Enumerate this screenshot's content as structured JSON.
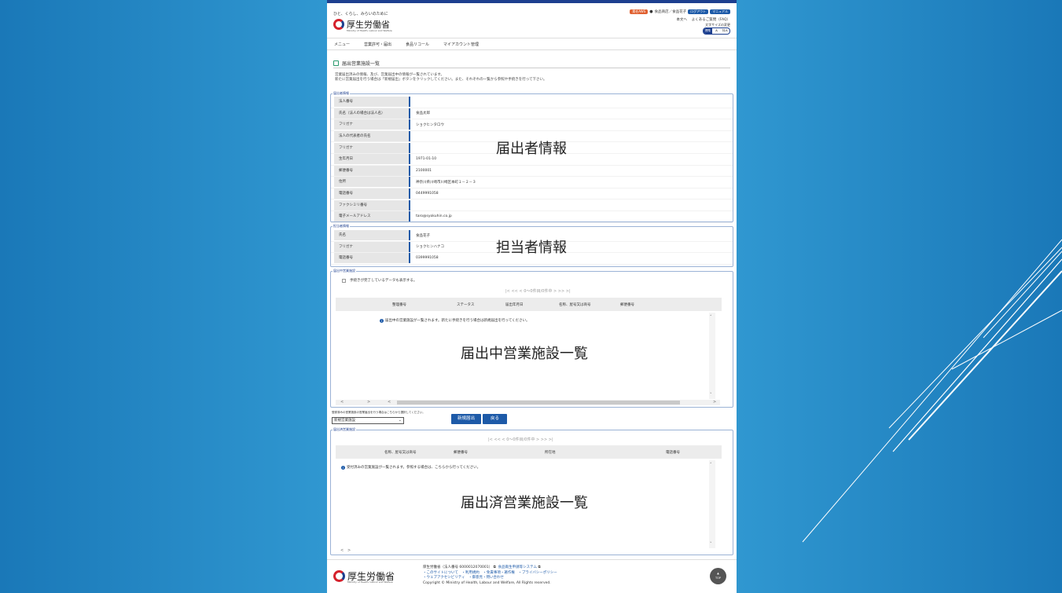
{
  "header": {
    "tagline": "ひと、くらし、みらいのために",
    "org_name": "厚生労働省",
    "org_name_en": "Ministry of Health, Labour and Welfare",
    "badge_red": "責任AWS",
    "user": "食品商店／食品花子",
    "logout": "ログアウト",
    "manual": "マニュアル",
    "link_main": "本文へ",
    "link_faq": "よくあるご質問（FAQ）",
    "font_size_label": "文字サイズの変更",
    "font_options": [
      "標準",
      "大",
      "特大"
    ]
  },
  "nav": {
    "items": [
      "メニュー",
      "営業許可・届出",
      "食品リコール",
      "マイアカウント管理"
    ]
  },
  "page": {
    "title": "届出営業施設一覧",
    "intro_line1": "営業届出済みの情報、及び、営業届出中の情報が一覧されています。",
    "intro_line2": "新たに営業届出を行う場合は「新規届出」ボタンをクリックしてください。また、それぞれの一覧から参照や手続きを行って下さい。"
  },
  "notifier": {
    "legend": "届出者情報",
    "overlay": "届出者情報",
    "rows": [
      {
        "label": "法人番号",
        "value": ""
      },
      {
        "label": "氏名（法人の場合は法人名）",
        "value": "食品太郎"
      },
      {
        "label": "フリガナ",
        "value": "ショクヒンタロウ"
      },
      {
        "label": "法人の代表者の氏名",
        "value": ""
      },
      {
        "label": "フリガナ",
        "value": ""
      },
      {
        "label": "生年月日",
        "value": "1971-01-10"
      },
      {
        "label": "郵便番号",
        "value": "2100001"
      },
      {
        "label": "住所",
        "value": "神奈川県川崎市川崎区本町１－２－３"
      },
      {
        "label": "電話番号",
        "value": "0449991058"
      },
      {
        "label": "ファクシミリ番号",
        "value": ""
      },
      {
        "label": "電子メールアドレス",
        "value": "taro@syokuhin.co.jp"
      }
    ]
  },
  "contact": {
    "legend": "担当者情報",
    "overlay": "担当者情報",
    "rows": [
      {
        "label": "氏名",
        "value": "食品花子"
      },
      {
        "label": "フリガナ",
        "value": "ショクヒンハナコ"
      },
      {
        "label": "電話番号",
        "value": "0399991058"
      }
    ]
  },
  "pending": {
    "legend": "届出中営業施設",
    "checkbox_label": "手続きが完了しているデータも表示する。",
    "pager": "|<  <<  <  0～0件目/0件中  >  >>  >|",
    "columns": [
      "整理番号",
      "ステータス",
      "届出年月日",
      "名称、屋号又は商号",
      "郵便番号"
    ],
    "info": "届出中の営業施設が一覧されます。新たに手続きを行う場合は新規届出を行ってください。",
    "overlay": "届出中営業施設一覧"
  },
  "actions": {
    "select_label": "登録済みの営業施設の営業届出を行う場合はこちらから選択してください。",
    "select_value": "新規営業施設",
    "new_button": "新規届出",
    "back_button": "戻る"
  },
  "completed": {
    "legend": "届出済営業施設",
    "pager": "|<  <<  <  0～0件目/0件中  >  >>  >|",
    "columns": [
      "名称、屋号又は商号",
      "郵便番号",
      "所在地",
      "電話番号"
    ],
    "info": "受付済みの営業施設が一覧されます。参照する場合は、こちらから行ってください。",
    "overlay": "届出済営業施設一覧"
  },
  "footer": {
    "org_name": "厚生労働省",
    "org_name_en": "Ministry of Health, Labour and Welfare",
    "line1": "厚生労働省（法人番号 6000012070001）",
    "line1b": "食品衛生申請等システム",
    "line2": "・このサイトについて　・利用規約　・免責事項・著作権　・プライバシーポリシー",
    "line3": "・ウェブアクセシビリティ　・御意見・問い合わせ",
    "copyright": "Copyright © Ministry of Health, Labour and Welfare, All Rights reserved.",
    "top_label": "TOP"
  }
}
